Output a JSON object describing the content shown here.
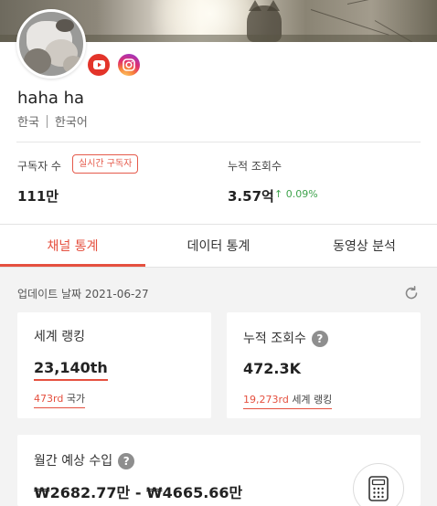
{
  "profile": {
    "name": "haha ha",
    "country": "한국",
    "language": "한국어"
  },
  "social": [
    {
      "icon": "youtube-icon",
      "color": "#e3342a"
    },
    {
      "icon": "instagram-icon",
      "color": "#e1306c"
    }
  ],
  "stats": {
    "subscribers_label": "구독자 수",
    "realtime_badge": "실시간 구독자",
    "subscribers_value": "111만",
    "views_label": "누적 조회수",
    "views_value": "3.57억",
    "views_change": "0.09%"
  },
  "tabs": [
    {
      "label": "채널 통계",
      "active": true
    },
    {
      "label": "데이터 통계",
      "active": false
    },
    {
      "label": "동영상 분석",
      "active": false
    }
  ],
  "update": {
    "label": "업데이트 날짜 2021-06-27"
  },
  "cards": {
    "world_rank": {
      "title": "세계 랭킹",
      "value": "23,140th",
      "sub_rank": "473rd",
      "sub_label": "국가"
    },
    "total_views": {
      "title": "누적 조회수",
      "value": "472.3K",
      "sub_rank": "19,273rd",
      "sub_label": "세계 랭킹"
    },
    "monthly_income": {
      "title": "월간 예상 수입",
      "value": "₩2682.77만 - ₩4665.66만"
    }
  },
  "colors": {
    "accent": "#e5503f",
    "positive": "#3fa34d",
    "background_grey": "#f3f3f3"
  }
}
